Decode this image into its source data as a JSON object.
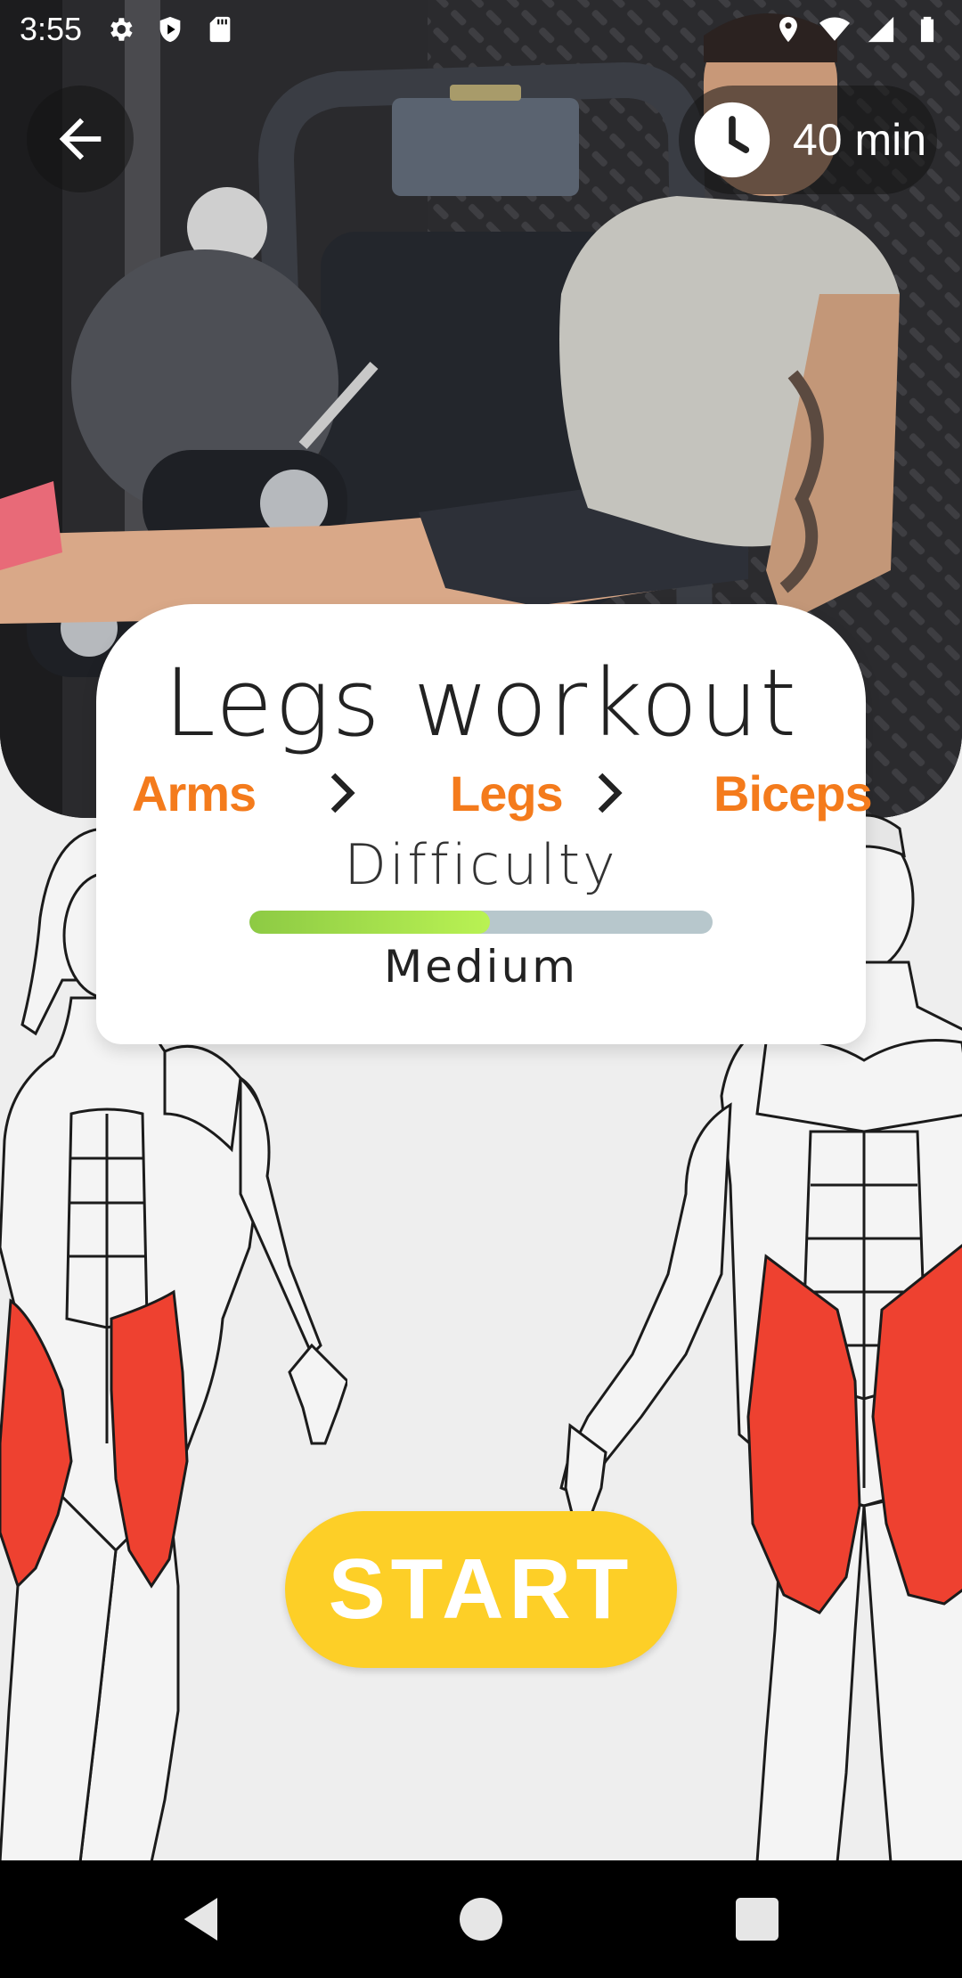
{
  "status_bar": {
    "time": "3:55",
    "left_icons": [
      "settings-icon",
      "shield-icon",
      "sd-card-icon"
    ],
    "right_icons": [
      "location-icon",
      "wifi-icon",
      "signal-icon",
      "battery-icon"
    ]
  },
  "hero": {
    "image": "gym-leg-curl-photo",
    "duration": "40 min"
  },
  "workout": {
    "title": "Legs workout",
    "breadcrumb": [
      "Arms",
      "Legs",
      "Biceps"
    ],
    "difficulty_label": "Difficulty",
    "difficulty_value": "Medium",
    "difficulty_level": 0.52
  },
  "start_button": {
    "label": "START"
  },
  "colors": {
    "accent_orange": "#f47b1c",
    "start_yellow": "#fdcf27",
    "muscle_red": "#ee4130",
    "progress_green": "#8dca44",
    "progress_track": "#b7c7cc"
  }
}
